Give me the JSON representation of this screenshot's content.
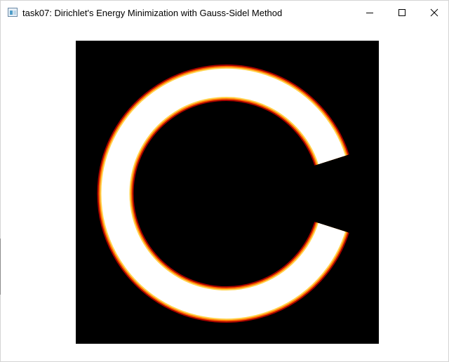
{
  "window": {
    "title": "task07: Dirichlet's Energy Minimization with Gauss-Sidel Method",
    "icon": "app-window-icon",
    "controls": {
      "minimize": "minimize-icon",
      "maximize": "maximize-icon",
      "close": "close-icon"
    }
  },
  "render": {
    "shape": "letter C",
    "background_color": "#000000",
    "fill_color": "#ffffff",
    "edge_colors": [
      "#ffd24a",
      "#ff7a00",
      "#b30000"
    ]
  }
}
